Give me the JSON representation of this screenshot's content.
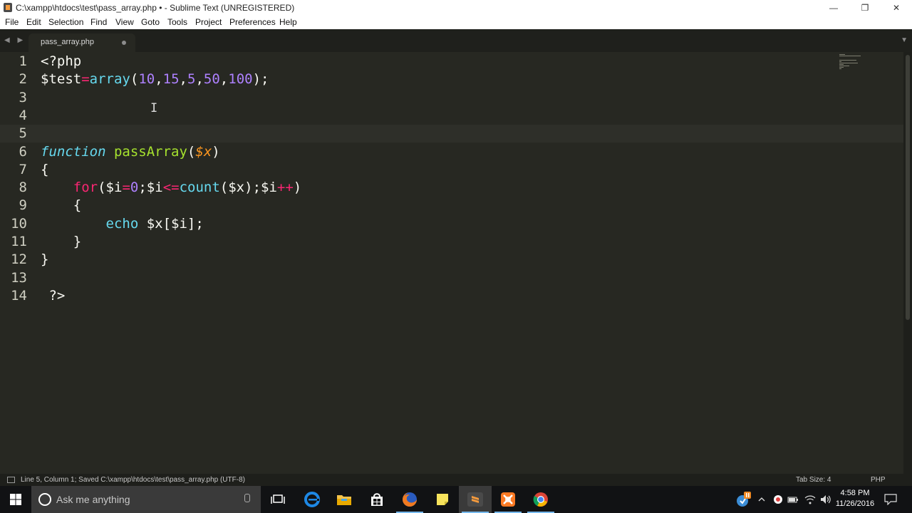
{
  "window": {
    "title": "C:\\xampp\\htdocs\\test\\pass_array.php • - Sublime Text (UNREGISTERED)",
    "controls": {
      "minimize": "—",
      "restore": "❐",
      "close": "✕"
    }
  },
  "menu": [
    "File",
    "Edit",
    "Selection",
    "Find",
    "View",
    "Goto",
    "Tools",
    "Project",
    "Preferences",
    "Help"
  ],
  "tabbar": {
    "nav_arrows": "◀ ▶",
    "active_tab": {
      "label": "pass_array.php",
      "modified": true
    },
    "dropdown": "▼"
  },
  "editor": {
    "line_numbers": [
      "1",
      "2",
      "3",
      "4",
      "5",
      "6",
      "7",
      "8",
      "9",
      "10",
      "11",
      "12",
      "13",
      "14"
    ],
    "current_line": 5,
    "code": {
      "l1": [
        "<?php"
      ],
      "l2": [
        "$test",
        "=",
        "array",
        "(",
        "10",
        ",",
        "15",
        ",",
        "5",
        ",",
        "50",
        ",",
        "100",
        ");"
      ],
      "l6": [
        "function",
        " ",
        "passArray",
        "(",
        "$x",
        ")"
      ],
      "l7": [
        "{"
      ],
      "l8": [
        "    ",
        "for",
        "(",
        "$i",
        "=",
        "0",
        ";",
        "$i",
        "<=",
        "count",
        "(",
        "$x",
        ");",
        "$i",
        "++",
        ")"
      ],
      "l9": [
        "    ",
        "{"
      ],
      "l10": [
        "        ",
        "echo",
        " ",
        "$x[$i];"
      ],
      "l11": [
        "    ",
        "}"
      ],
      "l12": [
        "}"
      ],
      "l14": [
        " ?>"
      ]
    },
    "cursor_glyph": "I"
  },
  "status": {
    "text": "Line 5, Column 1; Saved C:\\xampp\\htdocs\\test\\pass_array.php (UTF-8)",
    "tab_size": "Tab Size: 4",
    "syntax": "PHP"
  },
  "taskbar": {
    "search_placeholder": "Ask me anything",
    "apps": [
      "task-view",
      "edge",
      "file-explorer",
      "store",
      "firefox",
      "sticky-notes",
      "sublime-text",
      "xampp",
      "chrome"
    ],
    "active_app": "sublime-text",
    "clock": {
      "time": "4:58 PM",
      "date": "11/26/2016"
    }
  },
  "colors": {
    "editor_bg": "#272822",
    "keyword": "#f92672",
    "function": "#66d9ef",
    "number": "#ae81ff",
    "entity": "#a6e22e",
    "parameter": "#fd971f",
    "text": "#f8f8f2"
  }
}
